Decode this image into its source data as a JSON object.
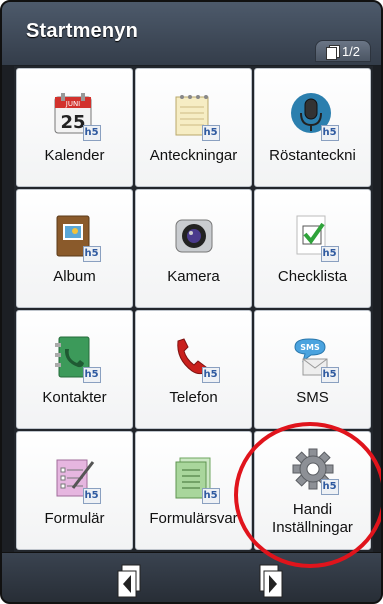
{
  "header": {
    "title": "Startmenyn",
    "page_indicator": "1/2"
  },
  "tiles": [
    {
      "label": "Kalender",
      "icon": "calendar-icon",
      "calendar_month": "JUNI",
      "calendar_day": "25"
    },
    {
      "label": "Anteckningar",
      "icon": "notepad-icon"
    },
    {
      "label": "Röstanteckni",
      "icon": "microphone-icon"
    },
    {
      "label": "Album",
      "icon": "photo-album-icon"
    },
    {
      "label": "Kamera",
      "icon": "camera-icon"
    },
    {
      "label": "Checklista",
      "icon": "checklist-icon"
    },
    {
      "label": "Kontakter",
      "icon": "contacts-book-icon"
    },
    {
      "label": "Telefon",
      "icon": "phone-handset-icon"
    },
    {
      "label": "SMS",
      "icon": "sms-bubble-icon",
      "bubble_text": "SMS"
    },
    {
      "label": "Formulär",
      "icon": "form-pen-icon"
    },
    {
      "label": "Formulärsvar",
      "icon": "form-answers-icon"
    },
    {
      "label": "Handi Inställningar",
      "label_line1": "Handi",
      "label_line2": "Inställningar",
      "icon": "settings-gear-icon"
    }
  ],
  "badge_text": "h5",
  "bottom_bar": {
    "prev_icon": "page-back-icon",
    "next_icon": "page-forward-icon"
  },
  "colors": {
    "header": "#3f4957",
    "highlight_circle": "#e0141c",
    "tile_background": "#ffffff"
  }
}
